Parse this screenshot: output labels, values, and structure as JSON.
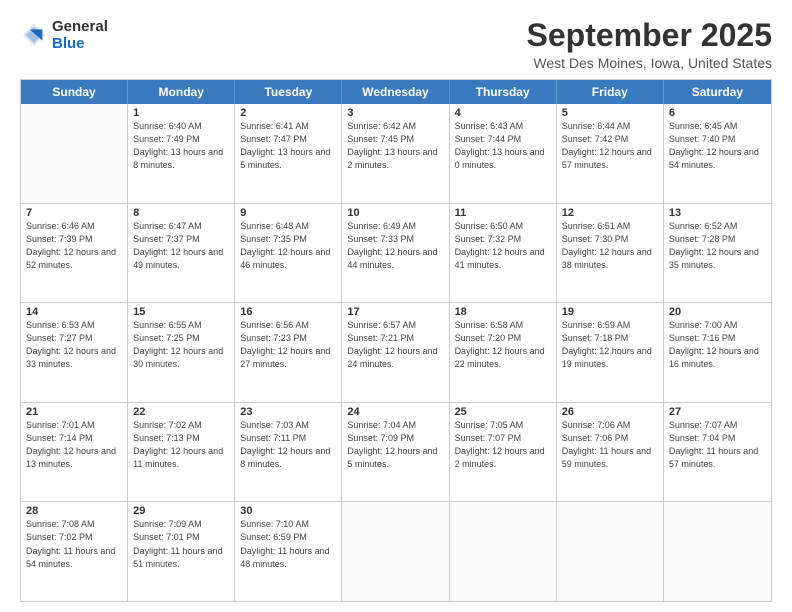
{
  "header": {
    "logo_line1": "General",
    "logo_line2": "Blue",
    "month": "September 2025",
    "location": "West Des Moines, Iowa, United States"
  },
  "days_of_week": [
    "Sunday",
    "Monday",
    "Tuesday",
    "Wednesday",
    "Thursday",
    "Friday",
    "Saturday"
  ],
  "weeks": [
    [
      {
        "day": "",
        "sunrise": "",
        "sunset": "",
        "daylight": "",
        "empty": true
      },
      {
        "day": "1",
        "sunrise": "Sunrise: 6:40 AM",
        "sunset": "Sunset: 7:49 PM",
        "daylight": "Daylight: 13 hours and 8 minutes."
      },
      {
        "day": "2",
        "sunrise": "Sunrise: 6:41 AM",
        "sunset": "Sunset: 7:47 PM",
        "daylight": "Daylight: 13 hours and 5 minutes."
      },
      {
        "day": "3",
        "sunrise": "Sunrise: 6:42 AM",
        "sunset": "Sunset: 7:45 PM",
        "daylight": "Daylight: 13 hours and 2 minutes."
      },
      {
        "day": "4",
        "sunrise": "Sunrise: 6:43 AM",
        "sunset": "Sunset: 7:44 PM",
        "daylight": "Daylight: 13 hours and 0 minutes."
      },
      {
        "day": "5",
        "sunrise": "Sunrise: 6:44 AM",
        "sunset": "Sunset: 7:42 PM",
        "daylight": "Daylight: 12 hours and 57 minutes."
      },
      {
        "day": "6",
        "sunrise": "Sunrise: 6:45 AM",
        "sunset": "Sunset: 7:40 PM",
        "daylight": "Daylight: 12 hours and 54 minutes."
      }
    ],
    [
      {
        "day": "7",
        "sunrise": "Sunrise: 6:46 AM",
        "sunset": "Sunset: 7:39 PM",
        "daylight": "Daylight: 12 hours and 52 minutes."
      },
      {
        "day": "8",
        "sunrise": "Sunrise: 6:47 AM",
        "sunset": "Sunset: 7:37 PM",
        "daylight": "Daylight: 12 hours and 49 minutes."
      },
      {
        "day": "9",
        "sunrise": "Sunrise: 6:48 AM",
        "sunset": "Sunset: 7:35 PM",
        "daylight": "Daylight: 12 hours and 46 minutes."
      },
      {
        "day": "10",
        "sunrise": "Sunrise: 6:49 AM",
        "sunset": "Sunset: 7:33 PM",
        "daylight": "Daylight: 12 hours and 44 minutes."
      },
      {
        "day": "11",
        "sunrise": "Sunrise: 6:50 AM",
        "sunset": "Sunset: 7:32 PM",
        "daylight": "Daylight: 12 hours and 41 minutes."
      },
      {
        "day": "12",
        "sunrise": "Sunrise: 6:51 AM",
        "sunset": "Sunset: 7:30 PM",
        "daylight": "Daylight: 12 hours and 38 minutes."
      },
      {
        "day": "13",
        "sunrise": "Sunrise: 6:52 AM",
        "sunset": "Sunset: 7:28 PM",
        "daylight": "Daylight: 12 hours and 35 minutes."
      }
    ],
    [
      {
        "day": "14",
        "sunrise": "Sunrise: 6:53 AM",
        "sunset": "Sunset: 7:27 PM",
        "daylight": "Daylight: 12 hours and 33 minutes."
      },
      {
        "day": "15",
        "sunrise": "Sunrise: 6:55 AM",
        "sunset": "Sunset: 7:25 PM",
        "daylight": "Daylight: 12 hours and 30 minutes."
      },
      {
        "day": "16",
        "sunrise": "Sunrise: 6:56 AM",
        "sunset": "Sunset: 7:23 PM",
        "daylight": "Daylight: 12 hours and 27 minutes."
      },
      {
        "day": "17",
        "sunrise": "Sunrise: 6:57 AM",
        "sunset": "Sunset: 7:21 PM",
        "daylight": "Daylight: 12 hours and 24 minutes."
      },
      {
        "day": "18",
        "sunrise": "Sunrise: 6:58 AM",
        "sunset": "Sunset: 7:20 PM",
        "daylight": "Daylight: 12 hours and 22 minutes."
      },
      {
        "day": "19",
        "sunrise": "Sunrise: 6:59 AM",
        "sunset": "Sunset: 7:18 PM",
        "daylight": "Daylight: 12 hours and 19 minutes."
      },
      {
        "day": "20",
        "sunrise": "Sunrise: 7:00 AM",
        "sunset": "Sunset: 7:16 PM",
        "daylight": "Daylight: 12 hours and 16 minutes."
      }
    ],
    [
      {
        "day": "21",
        "sunrise": "Sunrise: 7:01 AM",
        "sunset": "Sunset: 7:14 PM",
        "daylight": "Daylight: 12 hours and 13 minutes."
      },
      {
        "day": "22",
        "sunrise": "Sunrise: 7:02 AM",
        "sunset": "Sunset: 7:13 PM",
        "daylight": "Daylight: 12 hours and 11 minutes."
      },
      {
        "day": "23",
        "sunrise": "Sunrise: 7:03 AM",
        "sunset": "Sunset: 7:11 PM",
        "daylight": "Daylight: 12 hours and 8 minutes."
      },
      {
        "day": "24",
        "sunrise": "Sunrise: 7:04 AM",
        "sunset": "Sunset: 7:09 PM",
        "daylight": "Daylight: 12 hours and 5 minutes."
      },
      {
        "day": "25",
        "sunrise": "Sunrise: 7:05 AM",
        "sunset": "Sunset: 7:07 PM",
        "daylight": "Daylight: 12 hours and 2 minutes."
      },
      {
        "day": "26",
        "sunrise": "Sunrise: 7:06 AM",
        "sunset": "Sunset: 7:06 PM",
        "daylight": "Daylight: 11 hours and 59 minutes."
      },
      {
        "day": "27",
        "sunrise": "Sunrise: 7:07 AM",
        "sunset": "Sunset: 7:04 PM",
        "daylight": "Daylight: 11 hours and 57 minutes."
      }
    ],
    [
      {
        "day": "28",
        "sunrise": "Sunrise: 7:08 AM",
        "sunset": "Sunset: 7:02 PM",
        "daylight": "Daylight: 11 hours and 54 minutes."
      },
      {
        "day": "29",
        "sunrise": "Sunrise: 7:09 AM",
        "sunset": "Sunset: 7:01 PM",
        "daylight": "Daylight: 11 hours and 51 minutes."
      },
      {
        "day": "30",
        "sunrise": "Sunrise: 7:10 AM",
        "sunset": "Sunset: 6:59 PM",
        "daylight": "Daylight: 11 hours and 48 minutes."
      },
      {
        "day": "",
        "sunrise": "",
        "sunset": "",
        "daylight": "",
        "empty": true
      },
      {
        "day": "",
        "sunrise": "",
        "sunset": "",
        "daylight": "",
        "empty": true
      },
      {
        "day": "",
        "sunrise": "",
        "sunset": "",
        "daylight": "",
        "empty": true
      },
      {
        "day": "",
        "sunrise": "",
        "sunset": "",
        "daylight": "",
        "empty": true
      }
    ]
  ]
}
